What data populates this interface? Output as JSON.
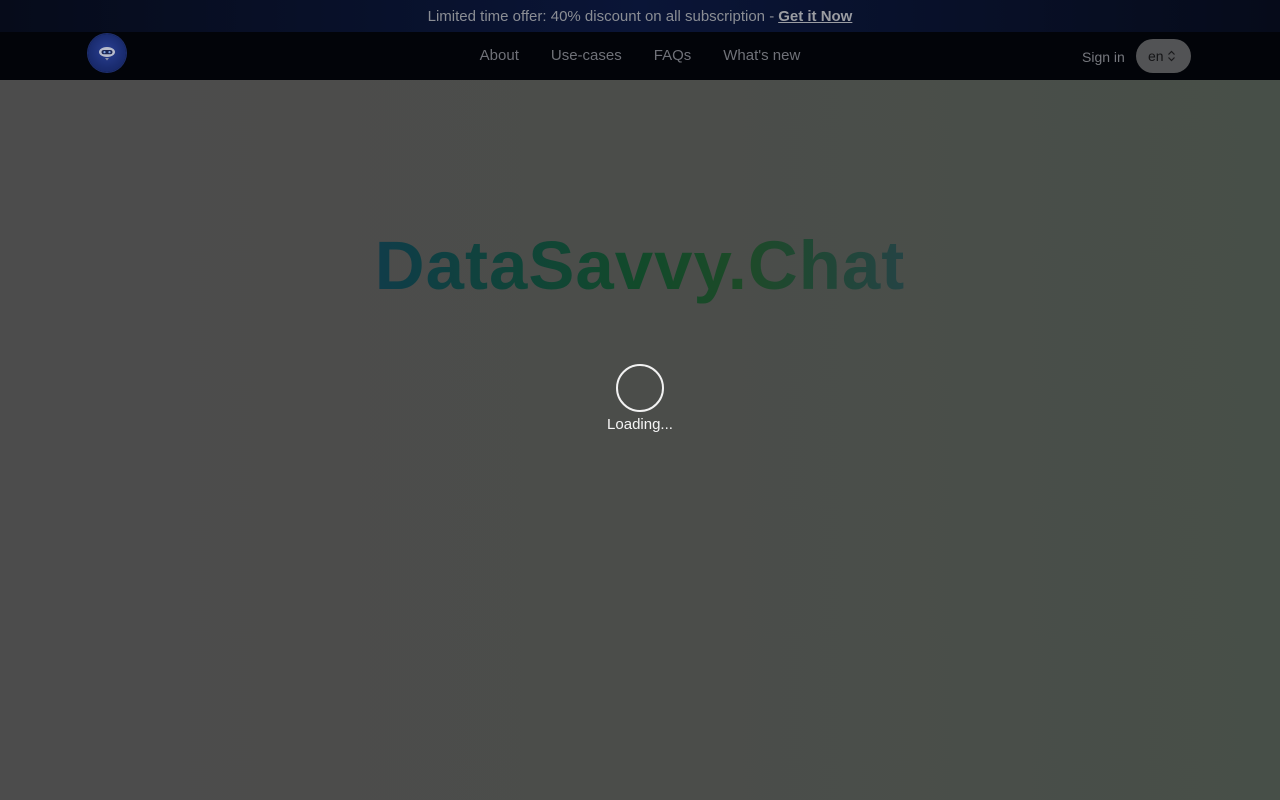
{
  "promo": {
    "text": "Limited time offer: 40% discount on all subscription -",
    "link_label": "Get it Now"
  },
  "nav": {
    "links": [
      "About",
      "Use-cases",
      "FAQs",
      "What's new"
    ],
    "sign_in": "Sign in",
    "language": "en"
  },
  "hero": {
    "title": "DataSavvy.Chat"
  },
  "status": {
    "loading_text": "Loading..."
  },
  "icons": {
    "logo": "robot-logo-icon",
    "language_chevrons": "chevron-up-down-icon",
    "spinner": "spinner-icon"
  },
  "colors": {
    "banner_bg": "#0a1537",
    "nav_bg": "#020409",
    "overlay": "#4c4c4c",
    "title_start": "#102764",
    "title_mid": "#124a2a",
    "title_end": "#2f3468"
  }
}
